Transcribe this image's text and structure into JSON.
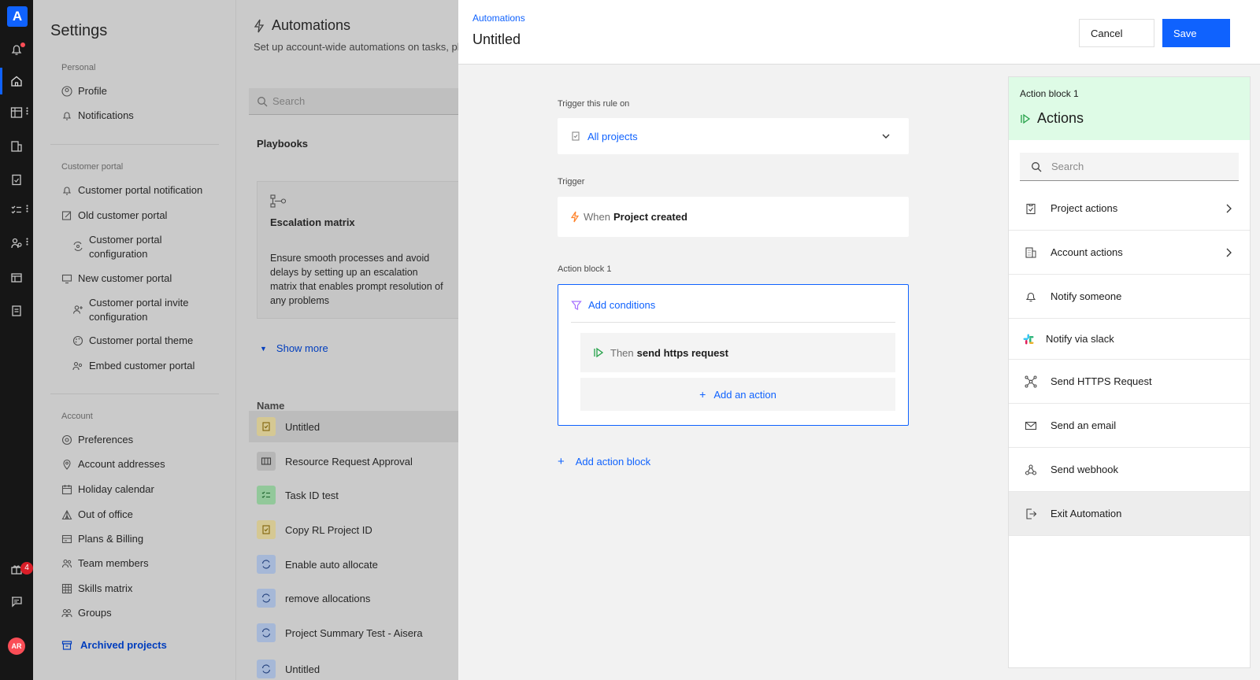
{
  "rail": {
    "logo": "A",
    "gift_badge": "4",
    "avatar": "AR"
  },
  "settings": {
    "title": "Settings",
    "personal_label": "Personal",
    "personal": [
      "Profile",
      "Notifications"
    ],
    "portal_label": "Customer portal",
    "portal": [
      "Customer portal notification",
      "Old customer portal",
      "Customer portal configuration",
      "New customer portal",
      "Customer portal invite configuration",
      "Customer portal theme",
      "Embed customer portal"
    ],
    "account_label": "Account",
    "account": [
      "Preferences",
      "Account addresses",
      "Holiday calendar",
      "Out of office",
      "Plans & Billing",
      "Team members",
      "Skills matrix",
      "Groups"
    ],
    "archived": "Archived projects"
  },
  "automations": {
    "title": "Automations",
    "description": "Set up account-wide automations on tasks, phas",
    "search_placeholder": "Search",
    "playbooks_label": "Playbooks",
    "card": {
      "title": "Escalation matrix",
      "description": "Ensure smooth processes and avoid delays by setting up an escalation matrix that enables prompt resolution of any problems"
    },
    "show_more": "Show more",
    "name_header": "Name",
    "rows": [
      "Untitled",
      "Resource Request Approval",
      "Task ID test",
      "Copy RL Project ID",
      "Enable auto allocate",
      "remove allocations",
      "Project Summary Test - Aisera",
      "Untitled"
    ]
  },
  "editor": {
    "breadcrumb": "Automations",
    "title": "Untitled",
    "cancel": "Cancel",
    "save": "Save",
    "trigger_on_label": "Trigger this rule on",
    "trigger_on_value": "All projects",
    "trigger_label": "Trigger",
    "trigger_when": "When",
    "trigger_event": "Project created",
    "action_block_label": "Action block 1",
    "add_conditions": "Add conditions",
    "then_word": "Then",
    "then_action": "send https request",
    "add_action": "Add an action",
    "add_action_block": "Add action block"
  },
  "actions_panel": {
    "block_label": "Action block 1",
    "title": "Actions",
    "search_placeholder": "Search",
    "items": [
      "Project actions",
      "Account actions",
      "Notify someone",
      "Notify via slack",
      "Send HTTPS Request",
      "Send an email",
      "Send webhook",
      "Exit Automation"
    ]
  },
  "colors": {
    "accent": "#0f62fe",
    "rail": "#161616",
    "success_bg": "#defbe6",
    "success_icon": "#24a148"
  }
}
